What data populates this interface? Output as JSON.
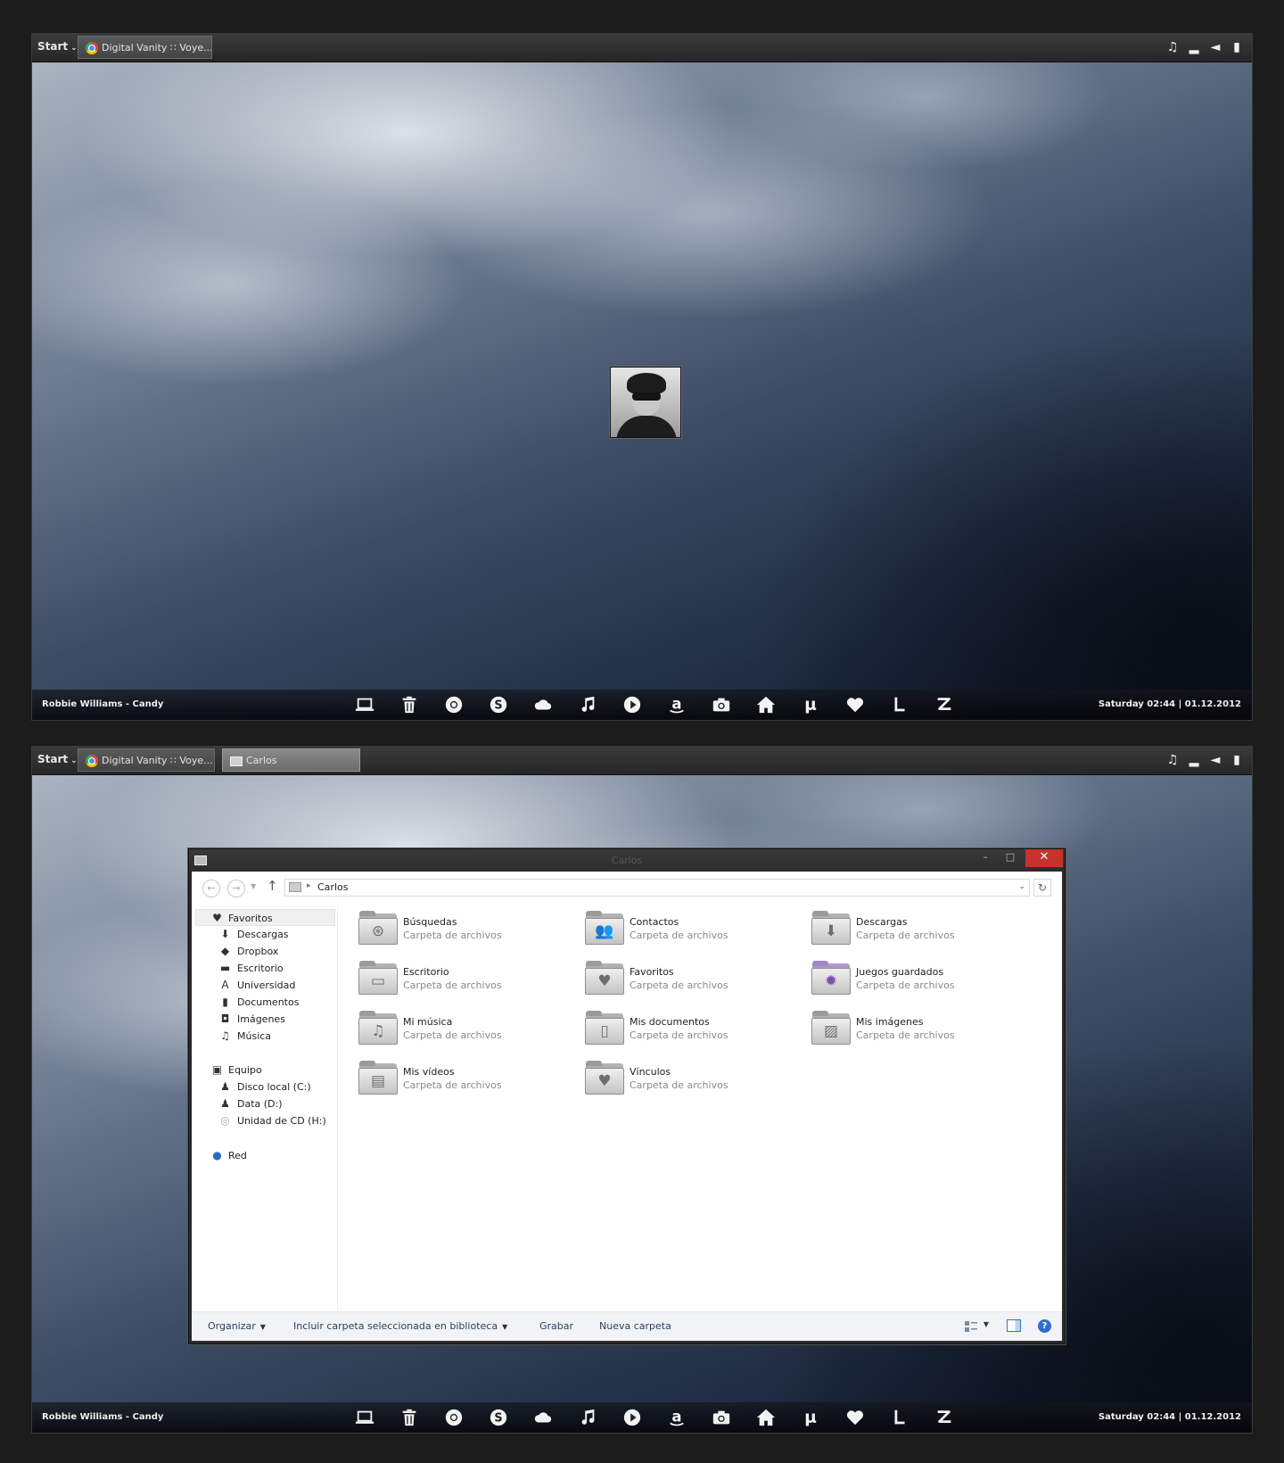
{
  "screens": [
    {
      "taskbar": {
        "start_label": "Start",
        "tasks": [
          {
            "label": "Digital Vanity ∷ Voye...",
            "icon": "chrome-icon"
          }
        ]
      },
      "dock": {
        "now_playing": "Robbie Williams - Candy",
        "clock": "Saturday 02:44 | 01.12.2012"
      }
    },
    {
      "taskbar": {
        "start_label": "Start",
        "tasks": [
          {
            "label": "Digital Vanity ∷ Voye...",
            "icon": "chrome-icon"
          },
          {
            "label": "Carlos",
            "icon": "folder-icon"
          }
        ]
      },
      "dock": {
        "now_playing": "Robbie Williams - Candy",
        "clock": "Saturday 02:44 | 01.12.2012"
      }
    }
  ],
  "tray_icons": [
    "music-note-icon",
    "signal-icon",
    "volume-icon",
    "battery-icon"
  ],
  "dock_icons": [
    "laptop-icon",
    "trash-icon",
    "chrome-icon",
    "skype-icon",
    "cloud-icon",
    "music-icon",
    "play-icon",
    "amazon-icon",
    "camera-icon",
    "home-icon",
    "utorrent-icon",
    "heart-icon",
    "lastfm-icon",
    "z-icon"
  ],
  "explorer": {
    "title": "Carlos",
    "address": "Carlos",
    "nav_pane": {
      "favorites": {
        "label": "Favoritos",
        "items": [
          "Descargas",
          "Dropbox",
          "Escritorio",
          "Universidad",
          "Documentos",
          "Imágenes",
          "Música"
        ]
      },
      "computer": {
        "label": "Equipo",
        "items": [
          "Disco local (C:)",
          "Data (D:)",
          "Unidad de CD (H:)"
        ]
      },
      "network": {
        "label": "Red"
      }
    },
    "folders": [
      {
        "name": "Búsquedas",
        "type": "Carpeta de archivos",
        "icon": "search-folder-icon"
      },
      {
        "name": "Contactos",
        "type": "Carpeta de archivos",
        "icon": "contacts-folder-icon"
      },
      {
        "name": "Descargas",
        "type": "Carpeta de archivos",
        "icon": "downloads-folder-icon"
      },
      {
        "name": "Escritorio",
        "type": "Carpeta de archivos",
        "icon": "desktop-folder-icon"
      },
      {
        "name": "Favoritos",
        "type": "Carpeta de archivos",
        "icon": "favorites-folder-icon"
      },
      {
        "name": "Juegos guardados",
        "type": "Carpeta de archivos",
        "icon": "saved-games-folder-icon"
      },
      {
        "name": "Mi música",
        "type": "Carpeta de archivos",
        "icon": "music-folder-icon"
      },
      {
        "name": "Mis documentos",
        "type": "Carpeta de archivos",
        "icon": "documents-folder-icon"
      },
      {
        "name": "Mis imágenes",
        "type": "Carpeta de archivos",
        "icon": "pictures-folder-icon"
      },
      {
        "name": "Mis vídeos",
        "type": "Carpeta de archivos",
        "icon": "videos-folder-icon"
      },
      {
        "name": "Vínculos",
        "type": "Carpeta de archivos",
        "icon": "links-folder-icon"
      }
    ],
    "commands": {
      "organize": "Organizar",
      "include_library": "Incluir carpeta seleccionada en biblioteca",
      "burn": "Grabar",
      "new_folder": "Nueva carpeta"
    }
  }
}
